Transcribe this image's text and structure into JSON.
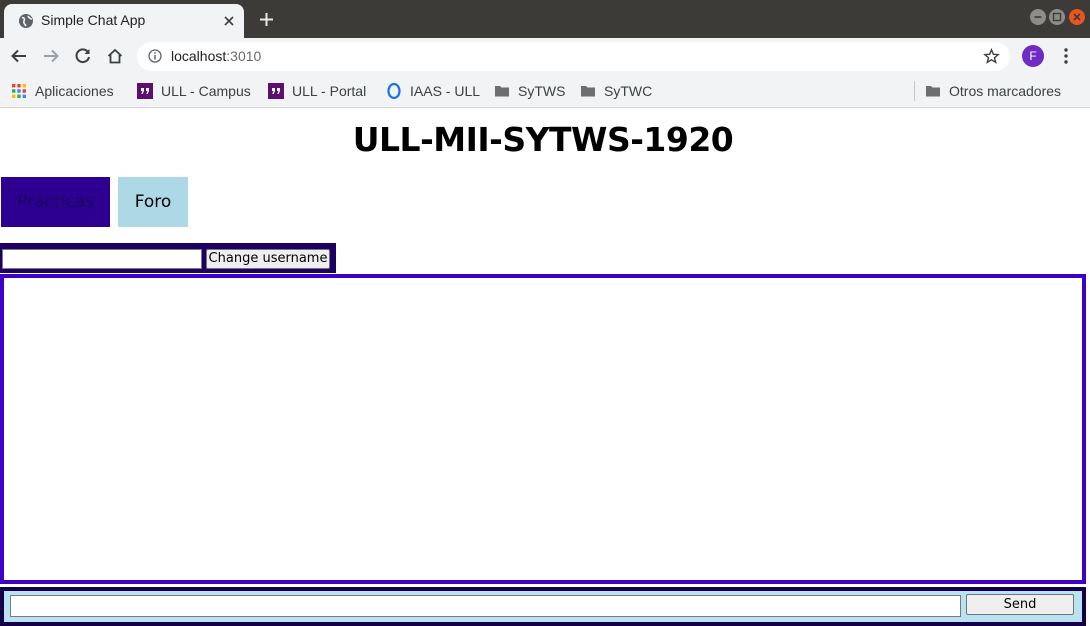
{
  "browser": {
    "tab_title": "Simple Chat App",
    "url_host": "localhost",
    "url_port": ":3010",
    "profile_initial": "F",
    "bookmarks": [
      {
        "label": "Aplicaciones",
        "icon": "apps-grid-icon"
      },
      {
        "label": "ULL - Campus",
        "icon": "ull-quote-icon"
      },
      {
        "label": "ULL - Portal",
        "icon": "ull-quote-icon"
      },
      {
        "label": "IAAS - ULL",
        "icon": "circle-o-icon"
      },
      {
        "label": "SyTWS",
        "icon": "folder-icon"
      },
      {
        "label": "SyTWC",
        "icon": "folder-icon"
      }
    ],
    "other_bookmarks": "Otros marcadores"
  },
  "page": {
    "title": "ULL-MII-SYTWS-1920",
    "nav": [
      {
        "label": "Prácticas"
      },
      {
        "label": "Foro"
      }
    ],
    "username_input": {
      "value": "",
      "placeholder": ""
    },
    "change_username_label": "Change username",
    "message_input": {
      "value": "",
      "placeholder": ""
    },
    "send_label": "Send"
  },
  "colors": {
    "practicas_bg": "#2e0091",
    "foro_bg": "#add8e6",
    "chat_border": "#3d00c7",
    "send_bar_bg": "#b9e3f3"
  }
}
